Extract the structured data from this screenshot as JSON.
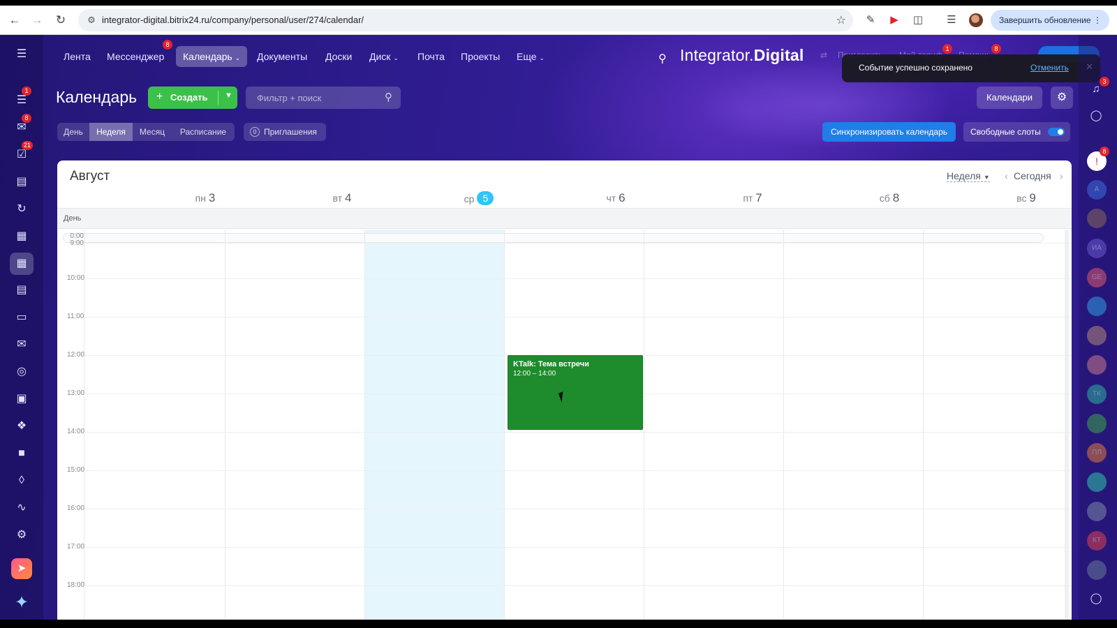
{
  "browser": {
    "url": "integrator-digital.bitrix24.ru/company/personal/user/274/calendar/",
    "update_button": "Завершить обновление"
  },
  "sidebar": {
    "badges": [
      "1",
      "8",
      "21"
    ]
  },
  "topnav": {
    "items": [
      {
        "label": "Лента"
      },
      {
        "label": "Мессенджер",
        "badge": "8"
      },
      {
        "label": "Календарь"
      },
      {
        "label": "Документы"
      },
      {
        "label": "Доски"
      },
      {
        "label": "Диск"
      },
      {
        "label": "Почта"
      },
      {
        "label": "Проекты"
      },
      {
        "label": "Еще"
      }
    ],
    "brand_light": "Integrator.",
    "brand_bold": "Digital",
    "invite_label": "Пригласить",
    "tariff_label": "Мой тариф",
    "tariff_badge": "1",
    "help_label": "Помощь",
    "help_badge": "8"
  },
  "toast": {
    "message": "Событие успешно сохранено",
    "undo": "Отменить"
  },
  "toolbar": {
    "title": "Календарь",
    "create_label": "Создать",
    "filter_placeholder": "Фильтр + поиск",
    "calendars_label": "Календари",
    "views": [
      "День",
      "Неделя",
      "Месяц",
      "Расписание"
    ],
    "active_view": "Неделя",
    "invites_count": "0",
    "invites_label": "Приглашения",
    "sync_label": "Синхронизировать календарь",
    "free_slots_label": "Свободные слоты",
    "free_slots_on": true
  },
  "rightrail": {
    "notif_badge": "3",
    "alert_badge": "8",
    "avatars": [
      "А",
      "",
      "ИА",
      "GE",
      "",
      "",
      "",
      "ТК",
      "",
      "ПЛ",
      "",
      "",
      "КТ",
      ""
    ]
  },
  "calendar": {
    "month": "Август",
    "view_select": "Неделя",
    "today_label": "Сегодня",
    "days": [
      {
        "dow": "пн",
        "num": "3"
      },
      {
        "dow": "вт",
        "num": "4"
      },
      {
        "dow": "ср",
        "num": "5",
        "today": true
      },
      {
        "dow": "чт",
        "num": "6"
      },
      {
        "dow": "пт",
        "num": "7"
      },
      {
        "dow": "сб",
        "num": "8"
      },
      {
        "dow": "вс",
        "num": "9"
      }
    ],
    "allday_label": "День",
    "hours": [
      "0:00",
      "9:00",
      "10:00",
      "11:00",
      "12:00",
      "13:00",
      "14:00",
      "15:00",
      "16:00",
      "17:00",
      "18:00"
    ],
    "event": {
      "title": "KTalk: Тема встречи",
      "time": "12:00 – 14:00",
      "day": "чт 6",
      "color": "#1e8c2c"
    }
  }
}
